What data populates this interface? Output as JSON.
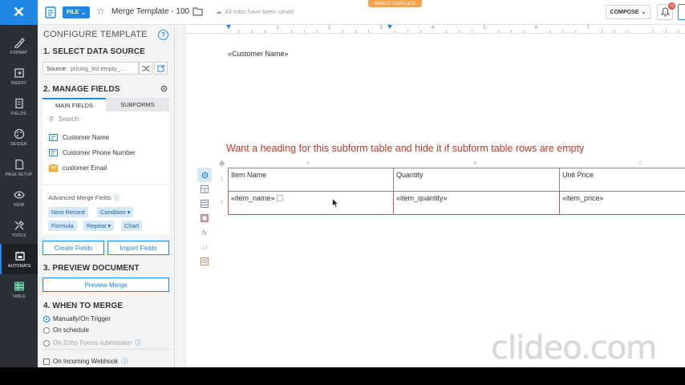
{
  "rail": {
    "items": [
      {
        "label": "FORMAT",
        "icon": "format-brush-icon"
      },
      {
        "label": "INSERT",
        "icon": "insert-icon"
      },
      {
        "label": "FIELDS",
        "icon": "fields-icon"
      },
      {
        "label": "DESIGN",
        "icon": "design-palette-icon"
      },
      {
        "label": "PAGE SETUP",
        "icon": "page-setup-icon"
      },
      {
        "label": "VIEW",
        "icon": "view-eye-icon"
      },
      {
        "label": "TOOLS",
        "icon": "tools-icon"
      },
      {
        "label": "AUTOMATE",
        "icon": "automate-icon"
      },
      {
        "label": "TABLE",
        "icon": "table-icon"
      }
    ],
    "active": "AUTOMATE"
  },
  "header": {
    "file_label": "FILE",
    "doc_title": "Merge Template - 100",
    "saved_status": "All edits have been saved",
    "mode_badge": "MERGE TEMPLATE",
    "compose_label": "COMPOSE",
    "notification_count": "29"
  },
  "panel": {
    "title": "CONFIGURE TEMPLATE",
    "section1": "1. SELECT DATA SOURCE",
    "source_label": "Source:",
    "source_value": "pricing_list empty_...",
    "section2": "2. MANAGE FIELDS",
    "tabs": [
      "MAIN FIELDS",
      "SUBFORMS"
    ],
    "search_placeholder": "Search",
    "fields": [
      {
        "label": "Customer Name",
        "icon": "field-text-icon"
      },
      {
        "label": "Customer Phone Number",
        "icon": "field-phone-icon"
      },
      {
        "label": "customer Email",
        "icon": "field-email-icon"
      }
    ],
    "advanced_title": "Advanced Merge Fields",
    "advanced_chips": [
      "Next Record",
      "Condition",
      "Formula",
      "Repeat",
      "Chart"
    ],
    "create_fields": "Create Fields",
    "import_fields": "Import Fields",
    "section3": "3. PREVIEW DOCUMENT",
    "preview_merge": "Preview Merge",
    "section4": "4. WHEN TO MERGE",
    "merge_options": [
      "Manually/On Trigger",
      "On schedule",
      "On Zoho Forms submission"
    ],
    "webhook_label": "On Incoming Webhook"
  },
  "ruler": {
    "numbers": [
      "1",
      "2",
      "3",
      "4",
      "5",
      "6",
      "7"
    ]
  },
  "document": {
    "customer_name_field": "«Customer Name»",
    "heading": "Want a heading for this subform table and hide it if subform table rows are empty",
    "column_letters": [
      "A",
      "B",
      "C"
    ],
    "row_numbers": [
      "1",
      "2"
    ],
    "table_headers": [
      "Item Name",
      "Quantity",
      "Unit Price"
    ],
    "table_row": [
      "«item_name»",
      "«item_quantity»",
      "«item_price»"
    ]
  },
  "watermark": "clideo.com",
  "colors": {
    "accent": "#1f88e5",
    "heading": "#c0392b",
    "rail": "#2b2f36",
    "badge": "#f5a34d"
  }
}
